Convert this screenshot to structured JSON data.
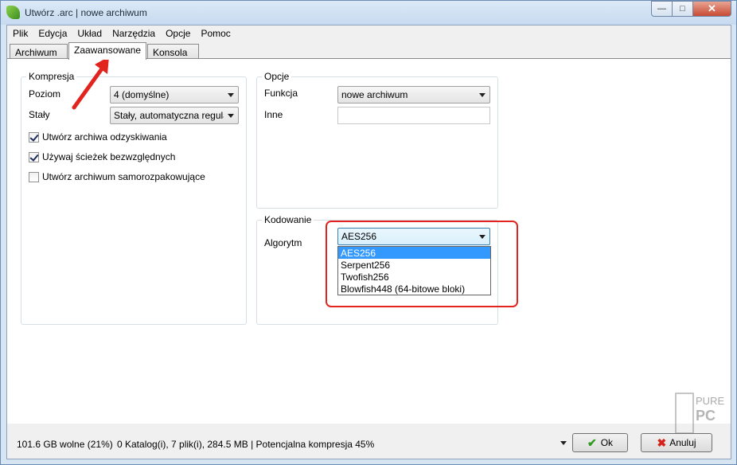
{
  "window": {
    "title": "Utwórz .arc | nowe archiwum"
  },
  "menu": [
    "Plik",
    "Edycja",
    "Układ",
    "Narzędzia",
    "Opcje",
    "Pomoc"
  ],
  "tabs": [
    "Archiwum",
    "Zaawansowane",
    "Konsola"
  ],
  "active_tab": "Zaawansowane",
  "compression": {
    "legend": "Kompresja",
    "level_label": "Poziom",
    "level_value": "4 (domyślne)",
    "solid_label": "Stały",
    "solid_value": "Stały, automatyczna regulacja",
    "checkboxes": [
      {
        "label": "Utwórz archiwa odzyskiwania",
        "checked": true
      },
      {
        "label": "Używaj ścieżek bezwzględnych",
        "checked": true
      },
      {
        "label": "Utwórz archiwum samorozpakowujące",
        "checked": false
      }
    ]
  },
  "options": {
    "legend": "Opcje",
    "function_label": "Funkcja",
    "function_value": "nowe archiwum",
    "other_label": "Inne",
    "other_value": ""
  },
  "encoding": {
    "legend": "Kodowanie",
    "algorithm_label": "Algorytm",
    "algorithm_value": "AES256",
    "algorithm_options": [
      "AES256",
      "Serpent256",
      "Twofish256",
      "Blowfish448 (64-bitowe bloki)"
    ],
    "highlight_color": "#e2241f"
  },
  "status": {
    "free_space": "101.6 GB wolne (21%)",
    "summary": "0 Katalog(i), 7 plik(i), 284.5 MB | Potencjalna kompresja 45%"
  },
  "buttons": {
    "ok": "Ok",
    "cancel": "Anuluj"
  },
  "icons": {
    "app": "app-leaf-icon",
    "ok": "check-icon",
    "cancel": "x-icon",
    "annotation": "red-arrow"
  },
  "watermark": "PURE PC"
}
